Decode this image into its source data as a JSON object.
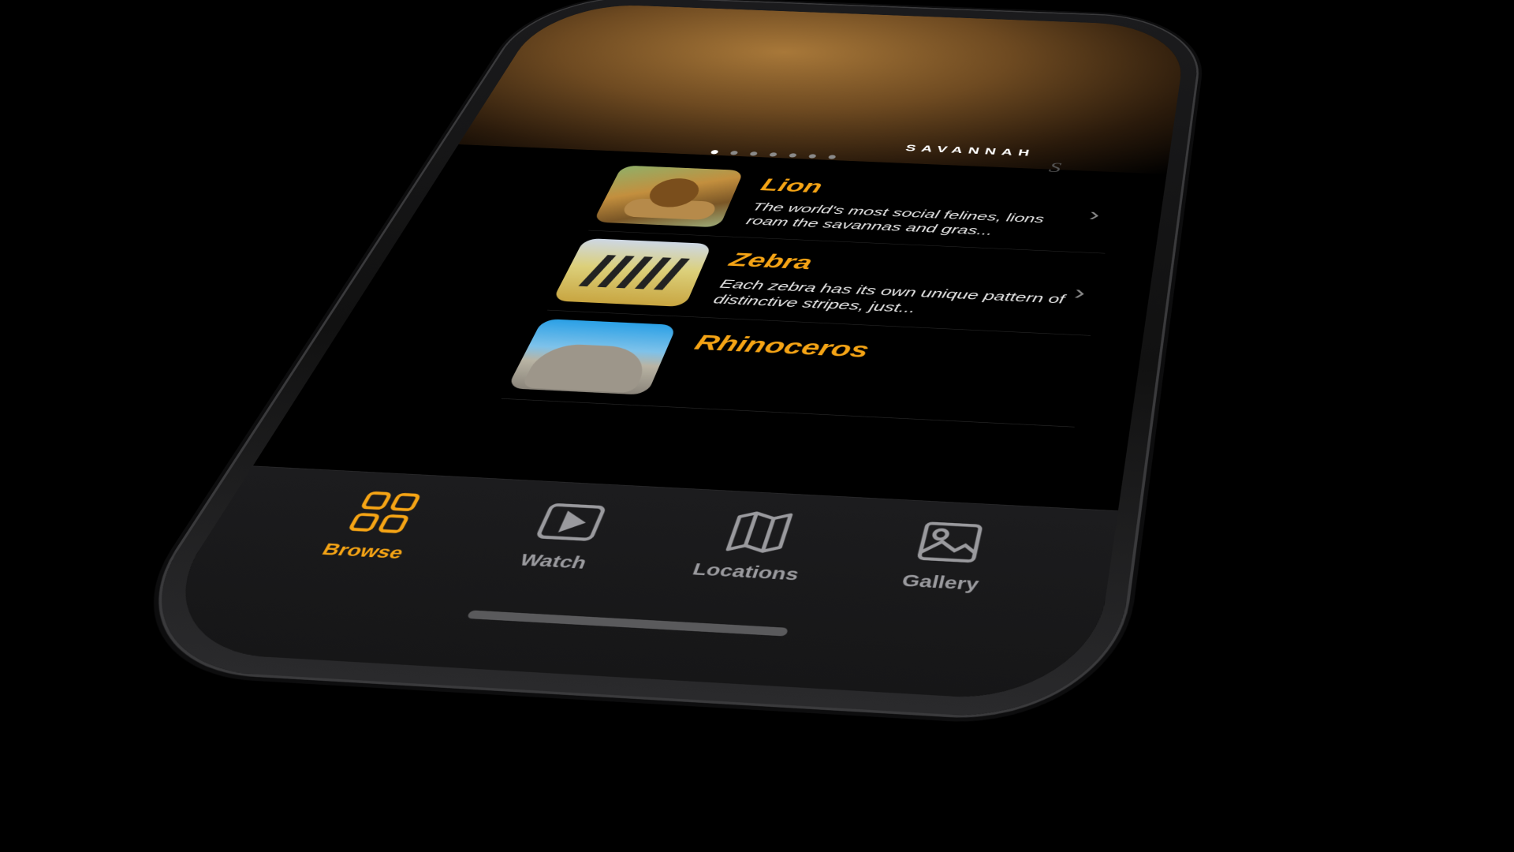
{
  "hero": {
    "label": "SAVANNAH",
    "decor_letter": "S",
    "page_count": 7,
    "active_page": 1
  },
  "animals": [
    {
      "name": "Lion",
      "description": "The world's most social felines, lions roam the savannas and gras...",
      "image": "lion-photo"
    },
    {
      "name": "Zebra",
      "description": "Each zebra has its own unique pattern of distinctive stripes, just...",
      "image": "zebra-photo"
    },
    {
      "name": "Rhinoceros",
      "description": "",
      "image": "rhinoceros-photo"
    }
  ],
  "tabbar": {
    "tabs": [
      {
        "label": "Browse",
        "icon": "grid-icon",
        "active": true
      },
      {
        "label": "Watch",
        "icon": "play-icon",
        "active": false
      },
      {
        "label": "Locations",
        "icon": "map-icon",
        "active": false
      },
      {
        "label": "Gallery",
        "icon": "photo-icon",
        "active": false
      }
    ]
  },
  "colors": {
    "accent": "#f5a415",
    "background": "#000000",
    "tab_inactive": "#9a9a9e"
  }
}
